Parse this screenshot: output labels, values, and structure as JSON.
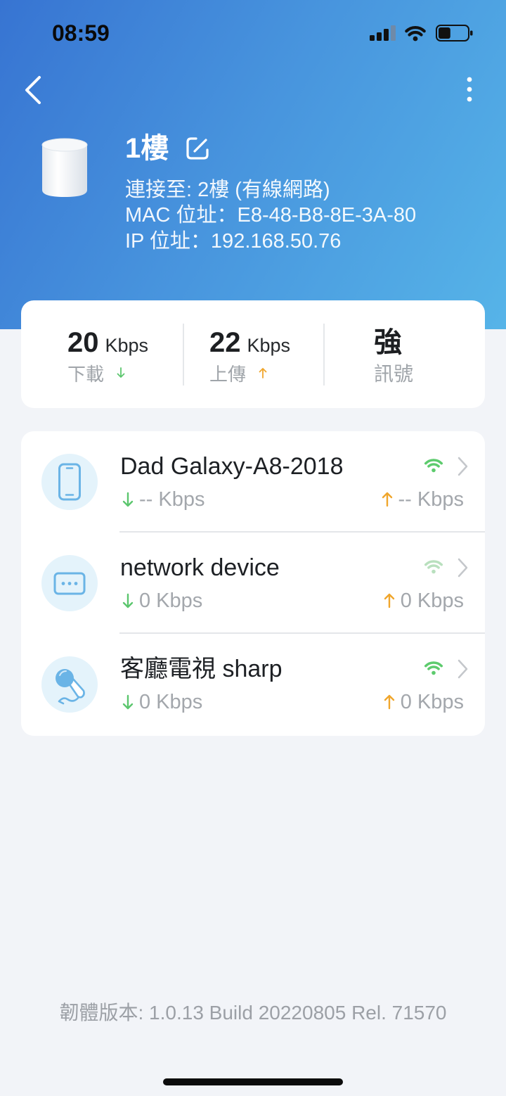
{
  "status_bar": {
    "time": "08:59",
    "battery_level": 0.42,
    "icons": [
      "cellular-signal-icon",
      "wifi-icon",
      "battery-icon"
    ]
  },
  "nav": {
    "back_icon": "chevron-left-icon",
    "menu_icon": "more-vertical-icon",
    "edit_icon": "edit-icon"
  },
  "device": {
    "name": "1樓",
    "connected_to": "連接至: 2樓 (有線網路)",
    "mac": "MAC 位址：E8-48-B8-8E-3A-80",
    "ip": "IP 位址：192.168.50.76"
  },
  "stats": {
    "download": {
      "value": "20",
      "unit": "Kbps",
      "label": "下載"
    },
    "upload": {
      "value": "22",
      "unit": "Kbps",
      "label": "上傳"
    },
    "signal": {
      "value": "強",
      "label": "訊號"
    }
  },
  "clients": [
    {
      "name": "Dad Galaxy-A8-2018",
      "icon": "phone-icon",
      "download": "-- Kbps",
      "upload": "-- Kbps",
      "wifi_color": "#5dcb6d"
    },
    {
      "name": "network device",
      "icon": "network-device-icon",
      "download": "0 Kbps",
      "upload": "0 Kbps",
      "wifi_color": "#b9e0be"
    },
    {
      "name": "客廳電視 sharp",
      "icon": "microphone-icon",
      "download": "0 Kbps",
      "upload": "0 Kbps",
      "wifi_color": "#5dcb6d"
    }
  ],
  "footer": {
    "firmware": "韌體版本: 1.0.13 Build 20220805 Rel. 71570"
  },
  "colors": {
    "header_start": "#3774d2",
    "header_end": "#56b4e8",
    "background": "#f2f4f8",
    "download": "#5cc66e",
    "upload": "#f0a62c",
    "client_icon": "#6ab4e6"
  }
}
